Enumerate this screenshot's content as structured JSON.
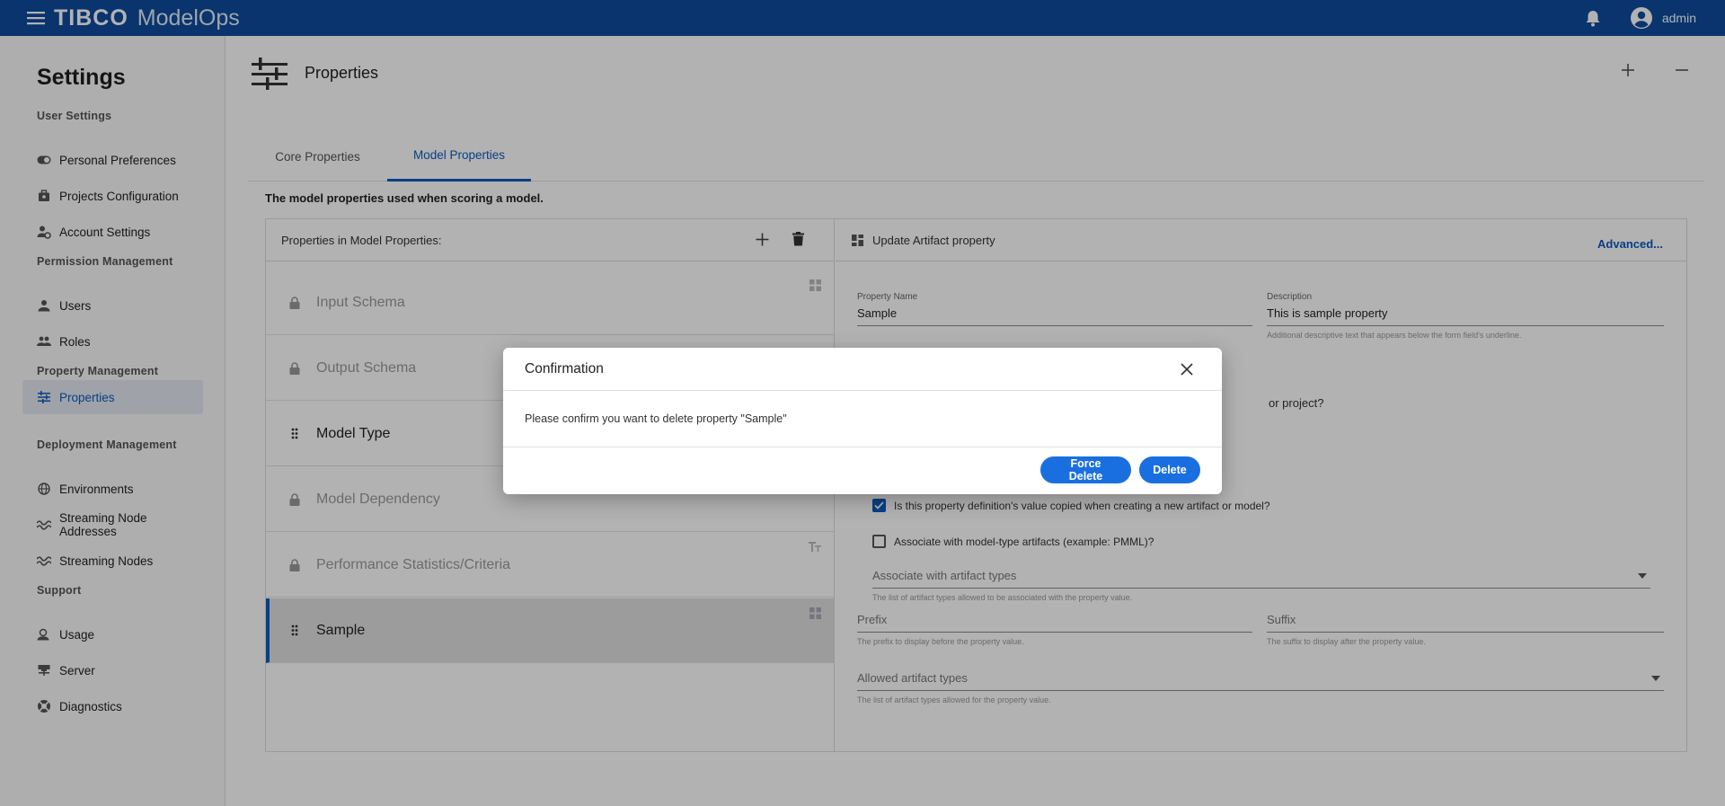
{
  "app": {
    "brand": "TIBCO",
    "product": "ModelOps",
    "user": "admin"
  },
  "sidebar": {
    "title": "Settings",
    "sections": [
      {
        "label": "User Settings",
        "items": [
          {
            "label": "Personal Preferences",
            "icon": "toggle-icon"
          },
          {
            "label": "Projects Configuration",
            "icon": "briefcase-icon"
          },
          {
            "label": "Account Settings",
            "icon": "user-gear-icon"
          }
        ]
      },
      {
        "label": "Permission Management",
        "items": [
          {
            "label": "Users",
            "icon": "person-icon"
          },
          {
            "label": "Roles",
            "icon": "people-icon"
          }
        ]
      },
      {
        "label": "Property Management",
        "items": [
          {
            "label": "Properties",
            "icon": "sliders-icon",
            "active": true
          }
        ]
      },
      {
        "label": "Deployment Management",
        "items": [
          {
            "label": "Environments",
            "icon": "globe-icon"
          },
          {
            "label": "Streaming Node Addresses",
            "icon": "wave-icon"
          },
          {
            "label": "Streaming Nodes",
            "icon": "wave-icon"
          }
        ]
      },
      {
        "label": "Support",
        "items": [
          {
            "label": "Usage",
            "icon": "usage-icon"
          },
          {
            "label": "Server",
            "icon": "server-icon"
          },
          {
            "label": "Diagnostics",
            "icon": "lifebuoy-icon"
          }
        ]
      }
    ]
  },
  "main": {
    "title": "Properties",
    "tabs": [
      {
        "label": "Core Properties",
        "active": false
      },
      {
        "label": "Model Properties",
        "active": true
      }
    ],
    "description": "The model properties used when scoring a model.",
    "list_header": "Properties in Model Properties:",
    "rows": [
      {
        "label": "Input Schema",
        "locked": true
      },
      {
        "label": "Output Schema",
        "locked": true
      },
      {
        "label": "Model Type",
        "locked": false
      },
      {
        "label": "Model Dependency",
        "locked": true
      },
      {
        "label": "Performance Statistics/Criteria",
        "locked": true
      },
      {
        "label": "Sample",
        "locked": false,
        "selected": true
      }
    ],
    "form": {
      "header": "Update Artifact property",
      "advanced": "Advanced...",
      "property_name_label": "Property Name",
      "property_name_value": "Sample",
      "description_label": "Description",
      "description_value": "This is sample property",
      "description_hint": "Additional descriptive text that appears below the form field's underline.",
      "partial_question": "or project?",
      "copied_question": "Is this property definition's value copied when creating a new artifact or model?",
      "associate_model_type": "Associate with model-type artifacts (example: PMML)?",
      "associate_artifact_types": "Associate with artifact types",
      "associate_artifact_types_hint": "The list of artifact types allowed to be associated with the property value.",
      "prefix_label": "Prefix",
      "prefix_hint": "The prefix to display before the property value.",
      "suffix_label": "Suffix",
      "suffix_hint": "The suffix to display after the property value.",
      "allowed_artifact_types": "Allowed artifact types",
      "allowed_artifact_types_hint": "The list of artifact types allowed for the property value."
    }
  },
  "dialog": {
    "title": "Confirmation",
    "message": "Please confirm you want to delete property \"Sample\"",
    "force_delete": "Force Delete",
    "delete": "Delete"
  },
  "colors": {
    "brand_bar": "#0d4b9e",
    "accent": "#0d5bbf",
    "button": "#1a6fe0"
  }
}
